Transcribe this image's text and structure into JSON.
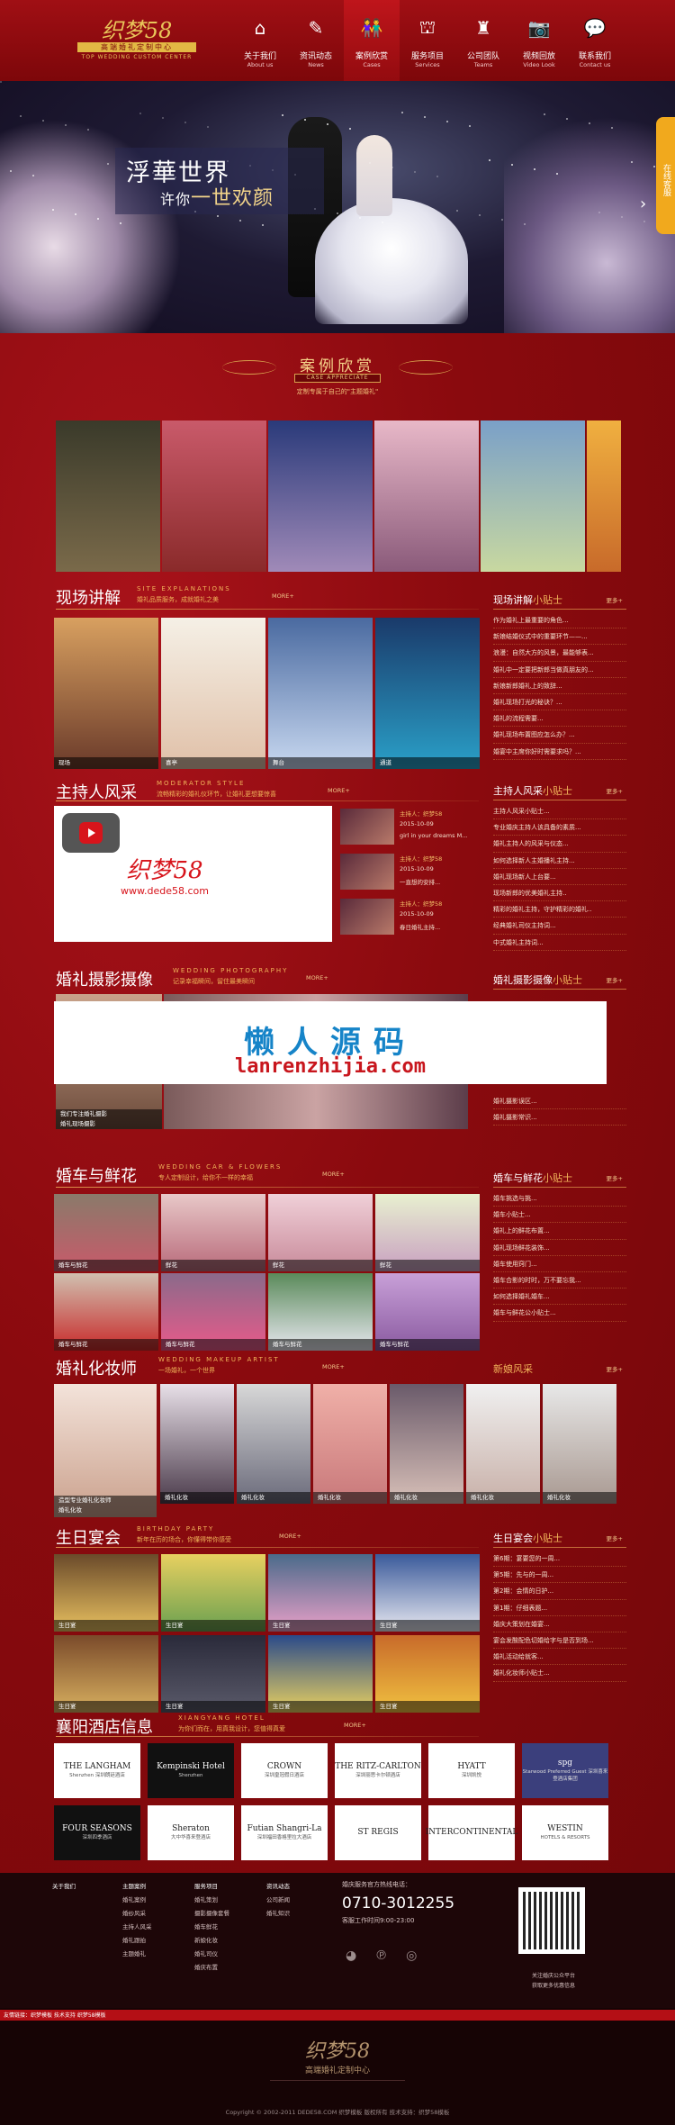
{
  "header": {
    "logo_main": "织梦58",
    "logo_sub": "高端婚礼定制中心",
    "logo_en": "TOP WEDDING CUSTOM CENTER",
    "nav": [
      {
        "cn": "关于我们",
        "en": "About us",
        "icon": "home-icon",
        "glyph": "⌂"
      },
      {
        "cn": "资讯动态",
        "en": "News",
        "icon": "news-icon",
        "glyph": "✎"
      },
      {
        "cn": "案例欣赏",
        "en": "Cases",
        "icon": "couple-icon",
        "glyph": "👫"
      },
      {
        "cn": "服务项目",
        "en": "Services",
        "icon": "dome-icon",
        "glyph": "⛫"
      },
      {
        "cn": "公司团队",
        "en": "Teams",
        "icon": "cake-icon",
        "glyph": "♜"
      },
      {
        "cn": "视频回放",
        "en": "Video Look",
        "icon": "camera-icon",
        "glyph": "📷"
      },
      {
        "cn": "联系我们",
        "en": "Contact us",
        "icon": "chat-icon",
        "glyph": "💬"
      }
    ]
  },
  "banner": {
    "line1": "浮華世界",
    "line2a": "许你",
    "line2b": "一世",
    "line2c": "欢颜",
    "side_tab": "在线客服"
  },
  "case": {
    "title": "案例欣赏",
    "en": "CASE APPRECIATE",
    "sub": "定制专属于自己的\"主题婚礼\""
  },
  "sections": {
    "site": {
      "title": "现场讲解",
      "en": "SITE EXPLANATIONS",
      "desc": "婚礼品质服务，成就婚礼之美",
      "more": "MORE+"
    },
    "host": {
      "title": "主持人风采",
      "en": "MODERATOR STYLE",
      "desc": "流畅精彩的婚礼仪环节，让婚礼更想要惊喜",
      "more": "MORE+"
    },
    "photo": {
      "title": "婚礼摄影摄像",
      "en": "WEDDING PHOTOGRAPHY",
      "desc": "记录幸福瞬间，留住最美瞬间",
      "more": "MORE+"
    },
    "car": {
      "title": "婚车与鲜花",
      "en": "WEDDING CAR & FLOWERS",
      "desc": "专人定制设计，给你不一样的幸福",
      "more": "MORE+"
    },
    "makeup": {
      "title": "婚礼化妆师",
      "en": "WEDDING MAKEUP ARTIST",
      "desc": "一场婚礼，一个世界",
      "more": "MORE+"
    },
    "birthday": {
      "title": "生日宴会",
      "en": "BIRTHDAY PARTY",
      "desc": "新年在历的场合，你懂得带你感受",
      "more": "MORE+"
    },
    "hotel": {
      "title": "襄阳酒店信息",
      "en": "XIANGYANG HOTEL",
      "desc": "为你们而在，用真我设计，您值得真爱",
      "more": "MORE+"
    }
  },
  "site_photos": [
    {
      "cap": "现场"
    },
    {
      "cap": "喜亭"
    },
    {
      "cap": "舞台"
    },
    {
      "cap": "通道"
    }
  ],
  "tips1": {
    "title_a": "现场讲解",
    "title_b": "小贴士",
    "more": "更多+",
    "items": [
      "作为婚礼上最重要的角色...",
      "新娘结婚仪式中的重要环节——...",
      "浪漫：自然大方的风景，最能够表...",
      "婚礼中一定要把新郎当做真朋友的...",
      "新娘新郎婚礼上的致辞...",
      "婚礼现场打光的秘诀？...",
      "婚礼的流程需要...",
      "婚礼现场布置图应怎么办？...",
      "婚宴中主席你好时需要求吗？..."
    ]
  },
  "tips2": {
    "title_a": "主持人风采",
    "title_b": "小贴士",
    "more": "更多+",
    "items": [
      "主持人风采小贴士...",
      "专业婚庆主持人该具备的素质...",
      "婚礼主持人的风采与仪态...",
      "如何选择新人主婚播礼主持...",
      "婚礼现场新人上台要...",
      "现场新郎的优美婚礼主持..",
      "精彩的婚礼主持，守护精彩的婚礼..",
      "经典婚礼司仪主持词...",
      "中式婚礼主持词..."
    ]
  },
  "tips3": {
    "title_a": "婚礼摄影摄像",
    "title_b": "小贴士",
    "more": "更多+",
    "items": [
      "婚礼摄影误区...",
      "婚礼摄影常识..."
    ]
  },
  "tips4": {
    "title_a": "婚车与鲜花",
    "title_b": "小贴士",
    "more": "更多+",
    "items": [
      "婚车挑选与挑...",
      "婚车小贴士...",
      "婚礼上的鲜花布置...",
      "婚礼现场鲜花装饰...",
      "婚车使用窍门...",
      "婚车合影的时时，万不要忘我...",
      "如何选择婚礼婚车...",
      "婚车与鲜花公小贴士..."
    ]
  },
  "tips5": {
    "title_a": "新娘风采",
    "title_b": "",
    "more": "更多+"
  },
  "tips6": {
    "title_a": "生日宴会",
    "title_b": "小贴士",
    "more": "更多+",
    "items": [
      "第6期：宴要您的一周...",
      "第5期：先与的一周...",
      "第2期：会情的日护...",
      "第1期：仔细表题...",
      "婚庆大策划在婚宴...",
      "宴会发酸配色切婚给字与是否到场...",
      "婚礼活动给就客...",
      "婚礼化妆师小贴士..."
    ]
  },
  "host": {
    "logo": "织梦58",
    "url": "www.dede58.com",
    "news": [
      {
        "a": "主持人：织梦58",
        "b": "2015-10-09",
        "c": "girl in your dreams M..."
      },
      {
        "a": "主持人：织梦58",
        "b": "2015-10-09",
        "c": "一直想的安排..."
      },
      {
        "a": "主持人：织梦58",
        "b": "2015-10-09",
        "c": "春日婚礼主持..."
      }
    ]
  },
  "watermark": {
    "t1": "懒人源码",
    "t2": "lanrenzhijia.com"
  },
  "photo_caps": {
    "c1": "我们专注婚礼摄影",
    "c2": "婚礼现场摄影"
  },
  "car_caps": [
    "婚车与鲜花",
    "鲜花",
    "鲜花",
    "鲜花",
    "婚车与鲜花",
    "婚车与鲜花",
    "婚车与鲜花",
    "婚车与鲜花"
  ],
  "makeup_caps": {
    "big1": "造型专业婚礼化妆师",
    "big2": "婚礼化妆",
    "small": "婚礼化妆"
  },
  "birthday_caps": [
    "生日宴",
    "生日宴",
    "生日宴",
    "生日宴",
    "生日宴",
    "生日宴",
    "生日宴",
    "生日宴"
  ],
  "hotels": [
    {
      "n": "THE LANGHAM",
      "s": "Shenzhen  深圳朗廷酒店",
      "style": "wt"
    },
    {
      "n": "Kempinski Hotel",
      "s": "Shenzhen",
      "style": "dk"
    },
    {
      "n": "CROWN",
      "s": "深圳皇冠假日酒店",
      "style": "wt"
    },
    {
      "n": "THE RITZ-CARLTON",
      "s": "深圳丽思卡尔顿酒店",
      "style": "wt"
    },
    {
      "n": "HYATT",
      "s": "深圳凯悦",
      "style": "wt"
    },
    {
      "n": "spg",
      "s": "Starwood Preferred Guest  深圳喜来登酒店集团",
      "style": "pp"
    },
    {
      "n": "FOUR SEASONS",
      "s": "深圳四季酒店",
      "style": "dk"
    },
    {
      "n": "Sheraton",
      "s": "大中华喜来登酒店",
      "style": "wt"
    },
    {
      "n": "Futian Shangri-La",
      "s": "深圳福田香格里拉大酒店",
      "style": "wt"
    },
    {
      "n": "ST REGIS",
      "s": "",
      "style": "wt"
    },
    {
      "n": "INTERCONTINENTAL",
      "s": "",
      "style": "wt"
    },
    {
      "n": "WESTIN",
      "s": "HOTELS & RESORTS",
      "style": "wt"
    }
  ],
  "footer": {
    "cols": [
      [
        "关于我们"
      ],
      [
        "主题案例",
        "婚礼案例",
        "婚纱风采",
        "主持人风采",
        "婚礼跟拍",
        "主题婚礼"
      ],
      [
        "服务项目",
        "婚礼策划",
        "摄影摄像套餐",
        "婚车鲜花",
        "新娘化妆",
        "婚礼司仪",
        "婚庆布置"
      ],
      [
        "资讯动态",
        "公司新闻",
        "婚礼知识"
      ]
    ],
    "hot1": "婚庆服务官方热线电话：",
    "tel": "0710-3012255",
    "time": "客服工作时间9:00-23:00",
    "qr1": "关注婚庆公众平台",
    "qr2": "获取更多优惠信息",
    "bar": "友情链接：织梦模板  技术支持  织梦58模板",
    "logo": "织梦58",
    "logo_sub": "高端婚礼定制中心",
    "copy": "Copyright © 2002-2011 DEDE58.COM 织梦模板 版权所有 技术支持：织梦58模板"
  },
  "colors": {
    "brand": "#8c0a0d",
    "gold": "#f1b45a",
    "nav_active": "#bf151b"
  }
}
